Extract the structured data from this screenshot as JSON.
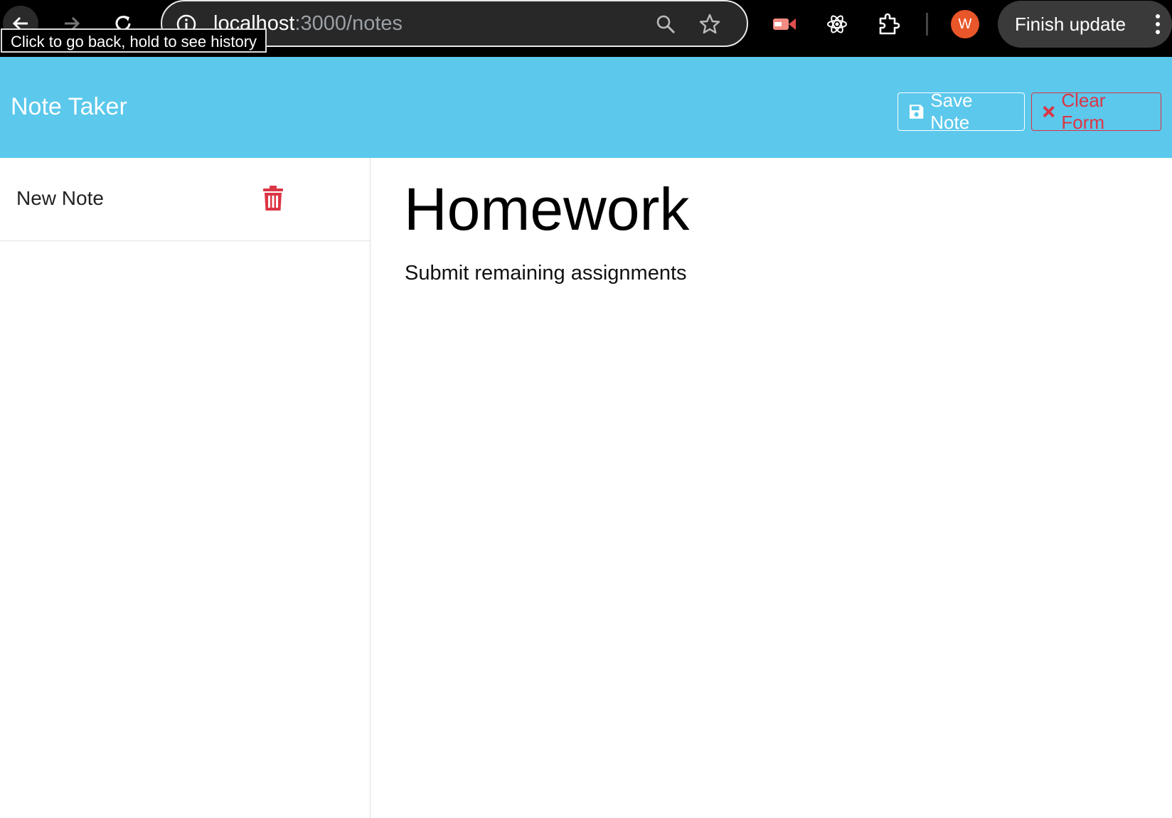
{
  "browser": {
    "url_host": "localhost",
    "url_path": ":3000/notes",
    "tooltip": "Click to go back, hold to see history",
    "profile_initial": "W",
    "update_button": "Finish update",
    "icons": [
      "back-arrow-icon",
      "forward-arrow-icon",
      "reload-icon",
      "info-icon",
      "zoom-icon",
      "star-icon",
      "screen-record-extension-icon",
      "react-devtools-icon",
      "extensions-puzzle-icon",
      "kebab-menu-icon"
    ],
    "colors": {
      "chrome_bg": "#000000",
      "avatar": "#e8562a"
    }
  },
  "header": {
    "title": "Note Taker",
    "save_label": "Save Note",
    "clear_label": "Clear Form",
    "colors": {
      "background": "#5bc8ec",
      "danger": "#dc3545"
    }
  },
  "sidebar": {
    "items": [
      {
        "label": "New Note",
        "icon": "trash-icon"
      }
    ]
  },
  "main": {
    "note_title": "Homework",
    "note_text": "Submit remaining assignments"
  }
}
